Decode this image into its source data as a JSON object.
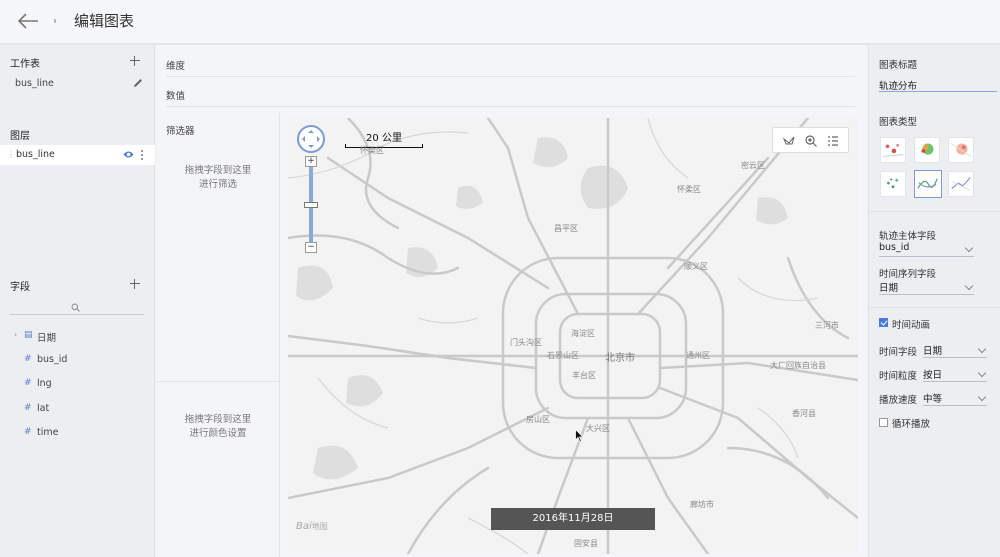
{
  "header": {
    "title": "编辑图表"
  },
  "worksheet": {
    "heading": "工作表",
    "item": "bus_line"
  },
  "layers": {
    "heading": "图层",
    "items": [
      {
        "label": "bus_line"
      }
    ]
  },
  "fields": {
    "heading": "字段",
    "items": [
      {
        "label": "日期",
        "icon": "calendar-icon"
      },
      {
        "label": "bus_id",
        "icon": "hash-icon"
      },
      {
        "label": "lng",
        "icon": "hash-icon"
      },
      {
        "label": "lat",
        "icon": "hash-icon"
      },
      {
        "label": "time",
        "icon": "hash-icon"
      }
    ]
  },
  "shelves": {
    "dimension": "维度",
    "value": "数值"
  },
  "filter": {
    "heading": "筛选器",
    "hint1": "拖拽字段到这里",
    "hint2": "进行筛选",
    "color_hint1": "拖拽字段到这里",
    "color_hint2": "进行颜色设置"
  },
  "map": {
    "scale": "20 公里",
    "timestamp": "2016年11月28日",
    "logo": "Bai",
    "logo_suffix": "地图",
    "labels": [
      {
        "text": "怀柔区",
        "big": false
      },
      {
        "text": "密云区",
        "big": false
      },
      {
        "text": "怀柔区",
        "big": false
      },
      {
        "text": "昌平区",
        "big": false
      },
      {
        "text": "顺义区",
        "big": false
      },
      {
        "text": "海淀区",
        "big": false
      },
      {
        "text": "门头沟区",
        "big": false
      },
      {
        "text": "石景山区",
        "big": false
      },
      {
        "text": "北京市",
        "big": true
      },
      {
        "text": "通州区",
        "big": false
      },
      {
        "text": "三河市",
        "big": false
      },
      {
        "text": "丰台区",
        "big": false
      },
      {
        "text": "大厂回族自治县",
        "big": false
      },
      {
        "text": "房山区",
        "big": false
      },
      {
        "text": "大兴区",
        "big": false
      },
      {
        "text": "香河县",
        "big": false
      },
      {
        "text": "廊坊市",
        "big": false
      },
      {
        "text": "固安县",
        "big": false
      }
    ]
  },
  "settings": {
    "title_heading": "图表标题",
    "title_value": "轨迹分布",
    "type_heading": "图表类型",
    "subject_heading": "轨迹主体字段",
    "subject_value": "bus_id",
    "sequence_heading": "时间序列字段",
    "sequence_value": "日期",
    "animation_label": "时间动画",
    "animation_on": true,
    "time_field_label": "时间字段",
    "time_field_value": "日期",
    "granularity_label": "时间粒度",
    "granularity_value": "按日",
    "speed_label": "播放速度",
    "speed_value": "中等",
    "loop_label": "循环播放",
    "loop_on": false
  },
  "colors": {
    "accent": "#4a7bde",
    "map_road": "#c9c9c9",
    "map_bg": "#f3f3f3"
  }
}
